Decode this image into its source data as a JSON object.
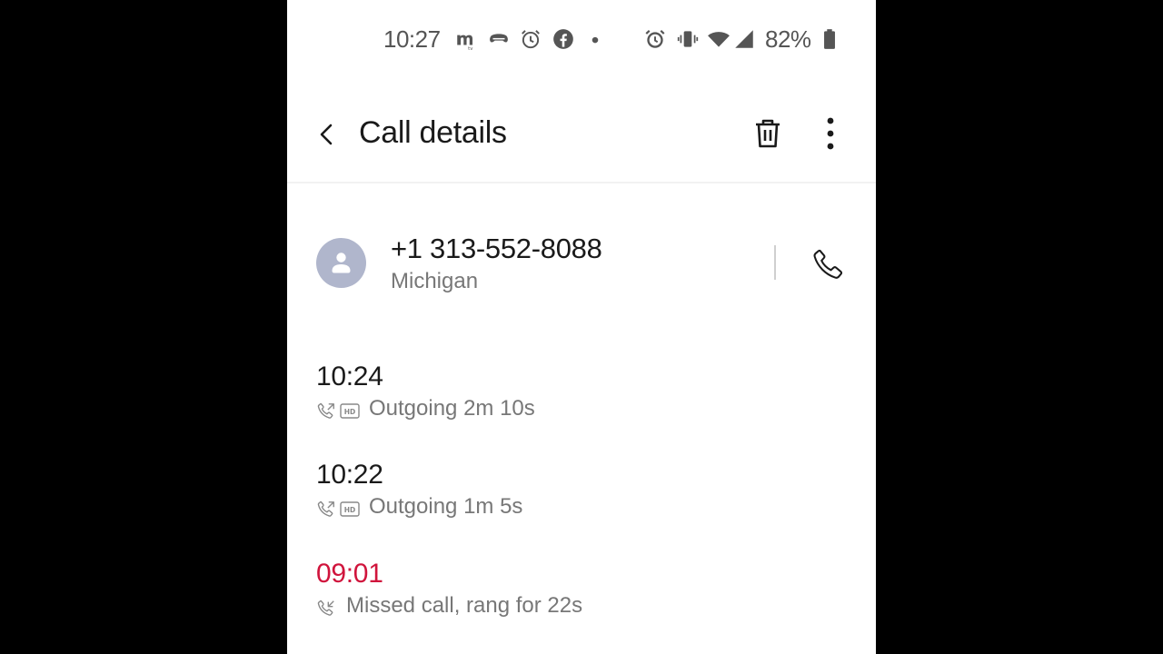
{
  "status_bar": {
    "time": "10:27",
    "battery": "82%",
    "icons": [
      "m-app-icon",
      "game-controller-icon",
      "alarm-clock-icon",
      "facebook-icon",
      "dot-icon",
      "alarm-icon",
      "vibrate-icon",
      "wifi-icon",
      "signal-icon",
      "battery-icon"
    ]
  },
  "app_bar": {
    "title": "Call details",
    "icons": [
      "back-arrow-icon",
      "delete-icon",
      "more-options-icon"
    ]
  },
  "contact": {
    "number": "+1 313-552-8088",
    "region": "Michigan",
    "icons": [
      "person-icon",
      "phone-icon"
    ]
  },
  "calls": [
    {
      "time": "10:24",
      "description": "Outgoing 2m 10s",
      "type": "outgoing",
      "hd": true
    },
    {
      "time": "10:22",
      "description": "Outgoing 1m 5s",
      "type": "outgoing",
      "hd": true
    },
    {
      "time": "09:01",
      "description": "Missed call, rang for 22s",
      "type": "missed",
      "hd": false
    }
  ],
  "colors": {
    "missed": "#d0143c",
    "avatar": "#b0b6cc",
    "text_primary": "#1a1a1a",
    "text_secondary": "#777777"
  }
}
